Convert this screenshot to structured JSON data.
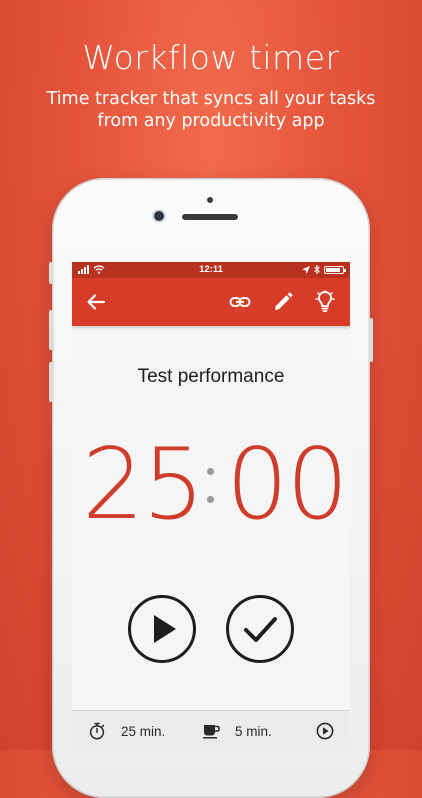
{
  "promo": {
    "title": "Workflow timer",
    "subtitle_line1": "Time tracker that syncs all your tasks",
    "subtitle_line2": "from any productivity app"
  },
  "status_bar": {
    "time": "12:11"
  },
  "app_bar": {
    "icons": [
      "back-arrow-icon",
      "link-icon",
      "edit-pencil-icon",
      "lightbulb-icon"
    ]
  },
  "task": {
    "title": "Test performance"
  },
  "timer": {
    "minutes": "25",
    "seconds": "00"
  },
  "controls": {
    "icons": [
      "play-icon",
      "checkmark-icon"
    ]
  },
  "footer": {
    "work_duration": "25 min.",
    "break_duration": "5 min.",
    "icons": [
      "stopwatch-icon",
      "coffee-cup-icon",
      "play-circle-icon"
    ]
  },
  "colors": {
    "accent": "#d63c28",
    "timer_digits": "#cf3c2a",
    "background": "#e4533a"
  }
}
